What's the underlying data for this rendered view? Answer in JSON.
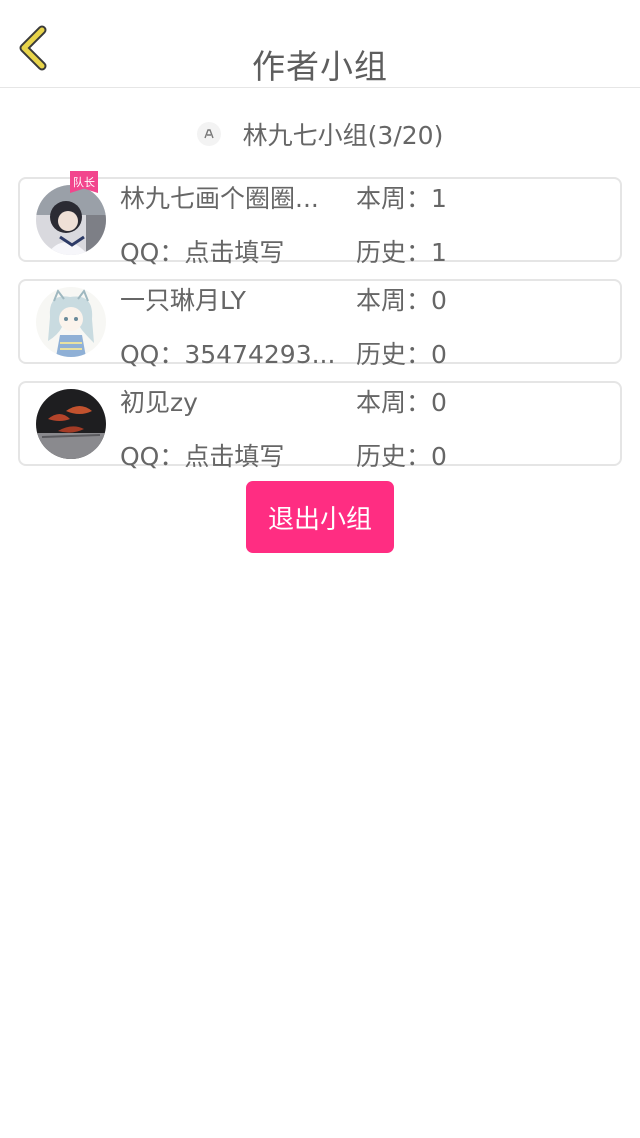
{
  "header": {
    "title": "作者小组"
  },
  "group": {
    "title": "林九七小组(3/20)"
  },
  "members": [
    {
      "name": "林九七画个圈圈...",
      "qq_label": "QQ：",
      "qq_value": "点击填写",
      "week_label": "本周：",
      "week_value": "1",
      "history_label": "历史：",
      "history_value": "1",
      "badge": "队长"
    },
    {
      "name": "一只琳月LY",
      "qq_label": "QQ：",
      "qq_value": "35474293...",
      "week_label": "本周：",
      "week_value": "0",
      "history_label": "历史：",
      "history_value": "0"
    },
    {
      "name": "初见zy",
      "qq_label": "QQ：",
      "qq_value": "点击填写",
      "week_label": "本周：",
      "week_value": "0",
      "history_label": "历史：",
      "history_value": "0"
    }
  ],
  "exit_button": {
    "label": "退出小组"
  },
  "colors": {
    "accent": "#ff2d82",
    "back_icon": "#e8d44a",
    "text": "#666666",
    "border": "#e5e5e5"
  }
}
